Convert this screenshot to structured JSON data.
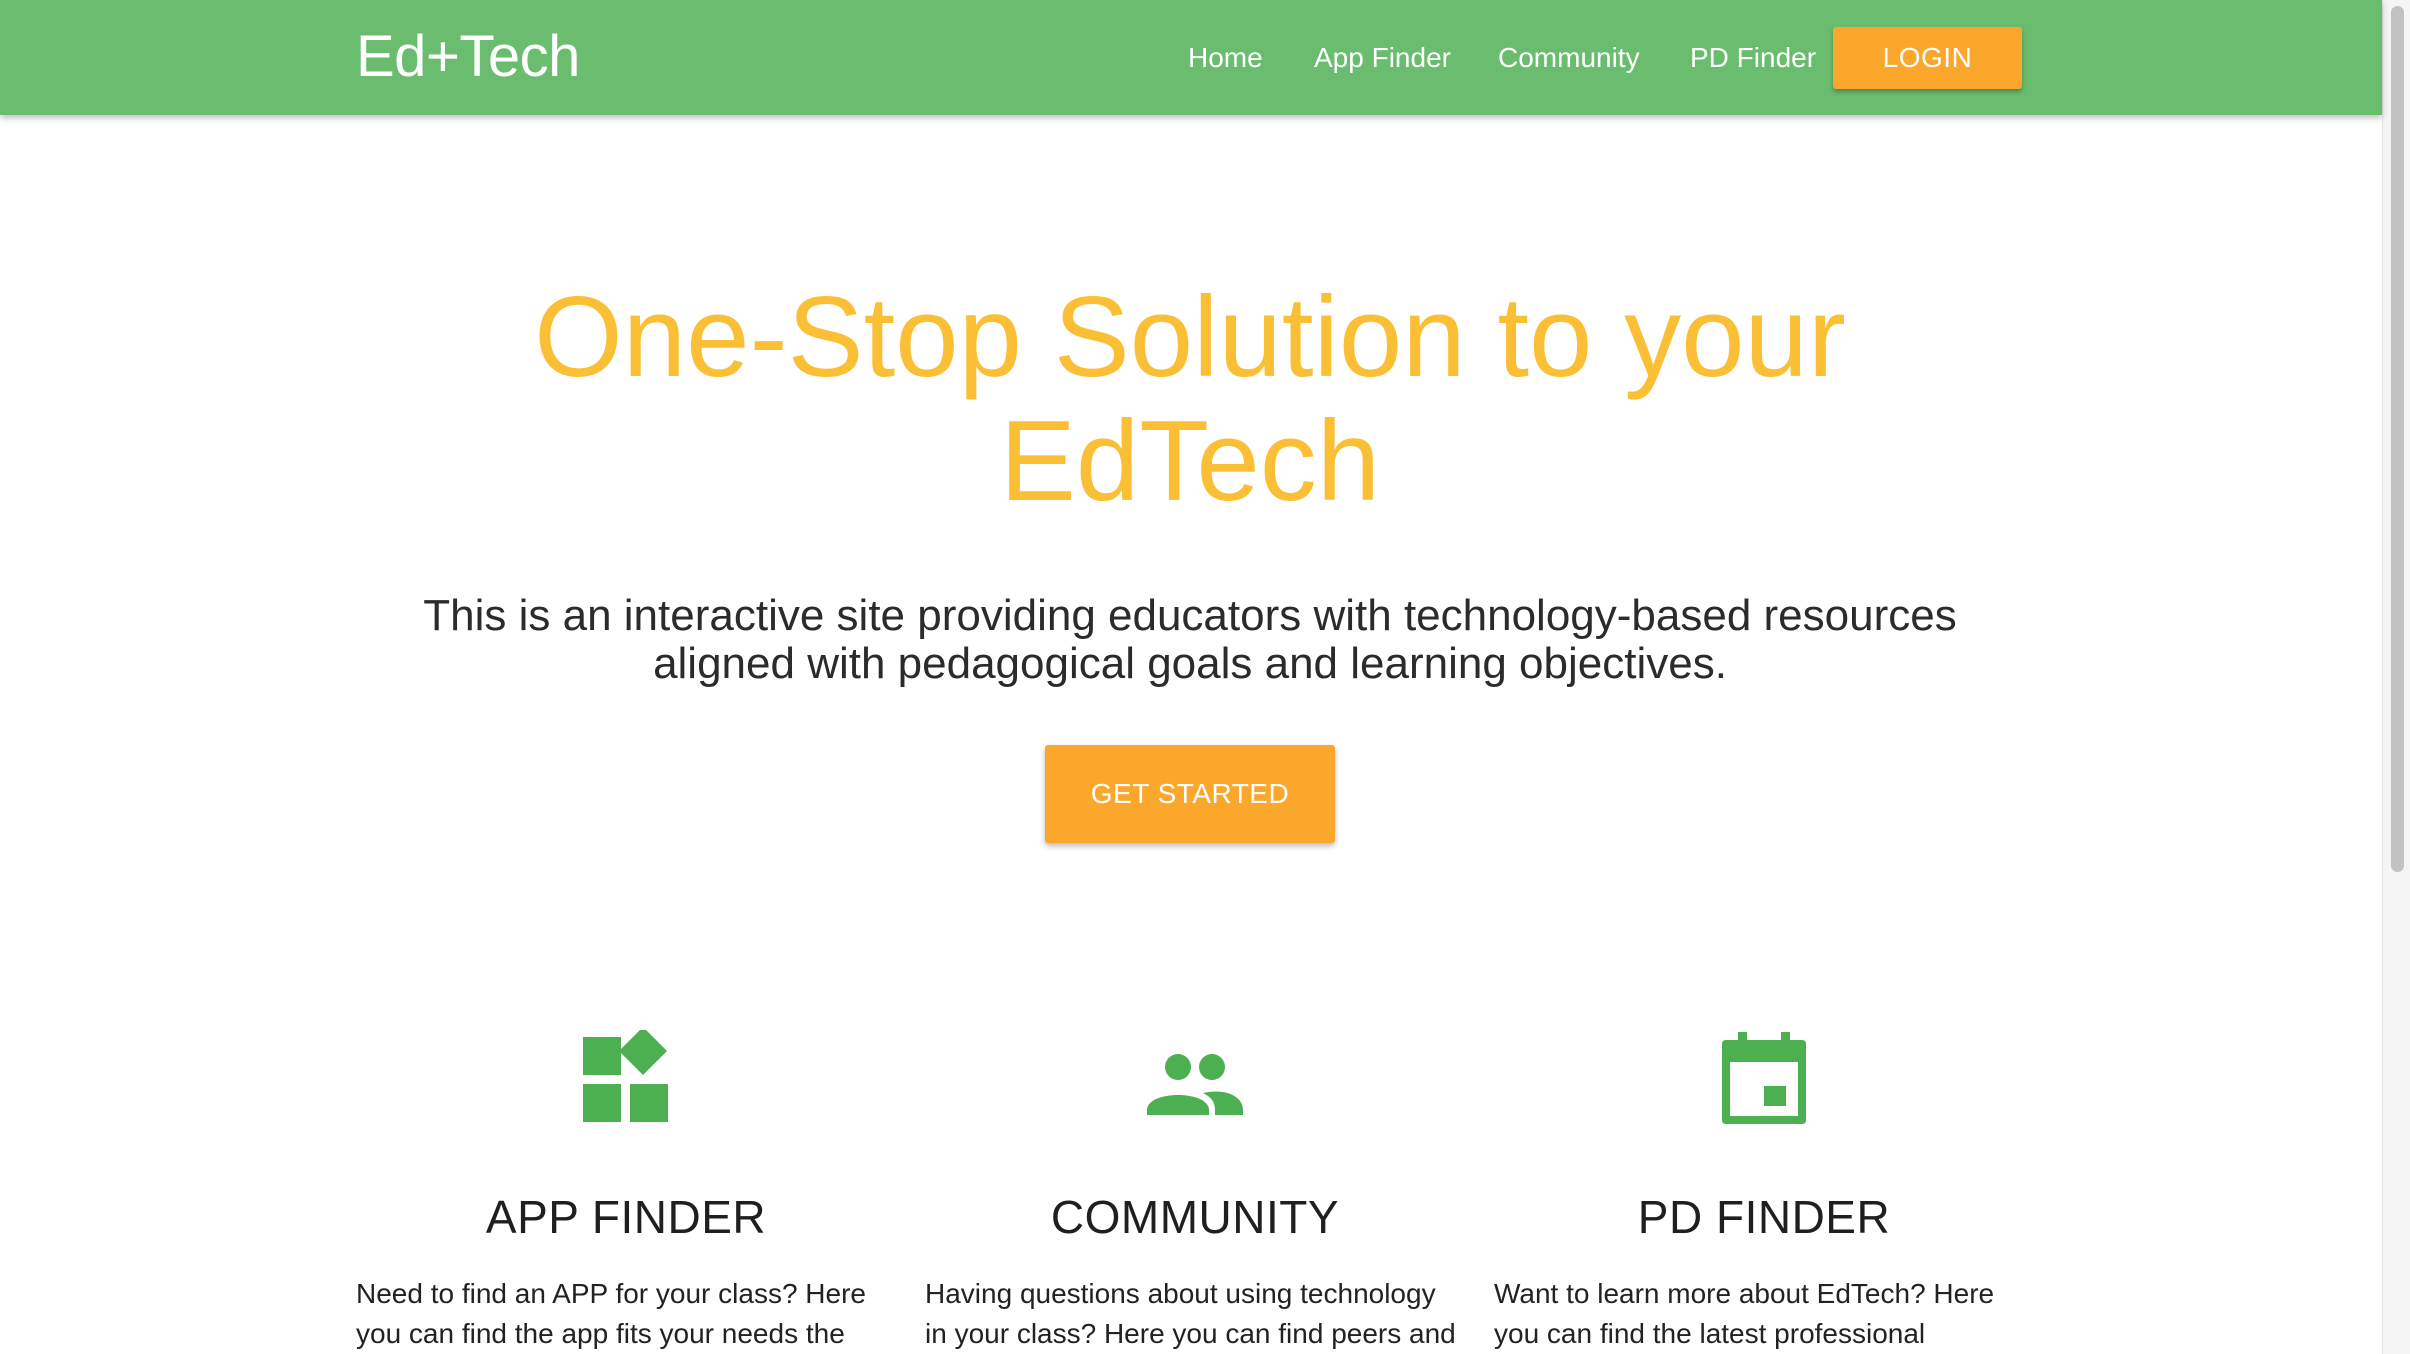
{
  "header": {
    "brand": "Ed+Tech",
    "nav": {
      "home": "Home",
      "app_finder": "App Finder",
      "community": "Community",
      "pd_finder": "PD Finder"
    },
    "login_label": "LOGIN"
  },
  "hero": {
    "title": "One-Stop Solution to your EdTech",
    "subtitle": "This is an interactive site providing educators with technology-based resources aligned with pedagogical goals and learning objectives.",
    "cta_label": "GET STARTED"
  },
  "features": [
    {
      "icon": "widgets-icon",
      "title": "APP FINDER",
      "text": "Need to find an APP for your class? Here you can find the app fits your needs the most,"
    },
    {
      "icon": "people-icon",
      "title": "COMMUNITY",
      "text": "Having questions about using technology in your class? Here you can find peers and"
    },
    {
      "icon": "calendar-icon",
      "title": "PD FINDER",
      "text": "Want to learn more about EdTech? Here you can find the latest professional development"
    }
  ],
  "colors": {
    "navbar": "#6abd6f",
    "accent_orange": "#fba72c",
    "hero_yellow": "#fbbf35",
    "icon_green": "#4caf50"
  }
}
